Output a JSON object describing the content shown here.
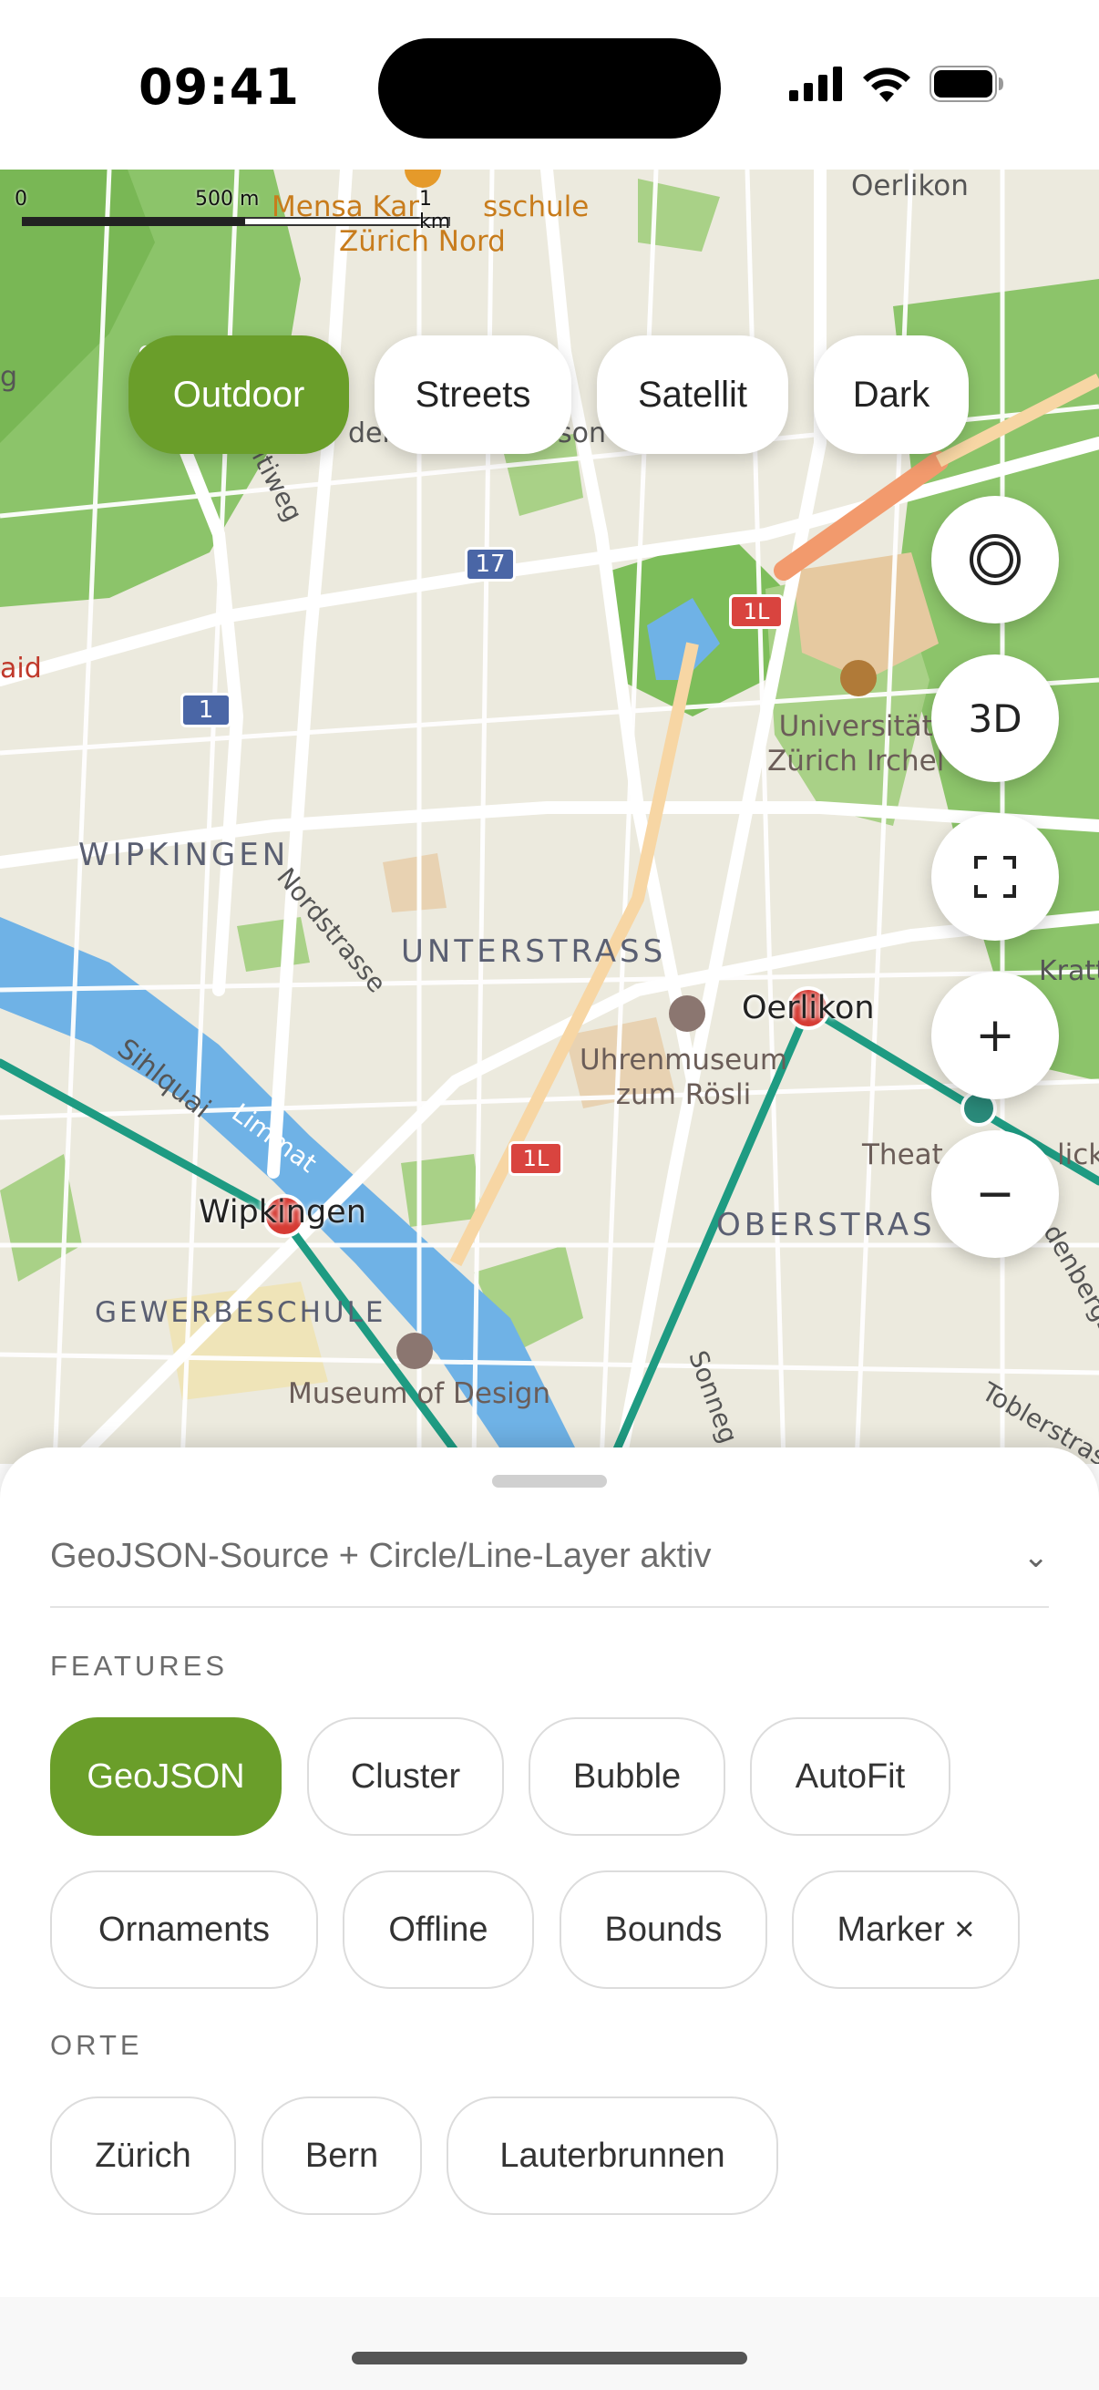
{
  "status_bar": {
    "time": "09:41"
  },
  "map": {
    "scale": {
      "zero": "0",
      "mid": "500 m",
      "end": "1 km"
    },
    "styles": [
      {
        "label": "Outdoor",
        "active": true
      },
      {
        "label": "Streets",
        "active": false
      },
      {
        "label": "Satellit",
        "active": false
      },
      {
        "label": "Dark",
        "active": false
      }
    ],
    "controls": {
      "locate_icon": "target-icon",
      "three_d": "3D",
      "fullscreen_icon": "fullscreen-icon",
      "zoom_in": "+",
      "zoom_out": "−"
    },
    "labels": {
      "oerlikon_top": "Oerlikon",
      "mensa": "Mensa Kar",
      "mensa_rest": "sschule",
      "zurich_nord": "Zürich Nord",
      "der": "der",
      "son": "son",
      "g": "g",
      "aid": "aid",
      "weg": "ltiweg",
      "wipkingen_district": "WIPKINGEN",
      "nordstrasse": "Nordstrasse",
      "unterstrass": "UNTERSTRASS",
      "oerlikon_station": "Oerlikon",
      "uhrenmuseum": "Uhrenmuseum\nzum Rösli",
      "universitaet": "Universität\nZürich Irchel",
      "kratten": "Kratten",
      "sihlquai": "Sihlquai",
      "limmat": "Limmat",
      "wipkingen_station": "Wipkingen",
      "gewerbeschule": "GEWERBESCHULE",
      "museum_design": "Museum of Design",
      "theat": "Theat",
      "lick": "lick",
      "oberstrass": "OBERSTRAS",
      "denbergs": "denbergs",
      "sonneg": "Sonneg",
      "toblerstr": "Toblerstras",
      "shield_17": "17",
      "shield_1": "1",
      "shield_1l_a": "1L",
      "shield_1l_b": "1L"
    }
  },
  "sheet": {
    "source_text": "GeoJSON-Source + Circle/Line-Layer aktiv",
    "chevron": "⌄",
    "features_title": "FEATURES",
    "features": [
      {
        "label": "GeoJSON",
        "active": true
      },
      {
        "label": "Cluster",
        "active": false
      },
      {
        "label": "Bubble",
        "active": false
      },
      {
        "label": "AutoFit",
        "active": false
      },
      {
        "label": "Ornaments",
        "active": false
      },
      {
        "label": "Offline",
        "active": false
      },
      {
        "label": "Bounds",
        "active": false
      },
      {
        "label": "Marker ×",
        "active": false
      }
    ],
    "places_title": "ORTE",
    "places": [
      {
        "label": "Zürich"
      },
      {
        "label": "Bern"
      },
      {
        "label": "Lauterbrunnen"
      }
    ]
  },
  "colors": {
    "accent": "#6a9e2a",
    "route": "#1e9b82",
    "river": "#6fb2e6",
    "park": "#9ccc6b",
    "forest": "#7dbd5a"
  }
}
